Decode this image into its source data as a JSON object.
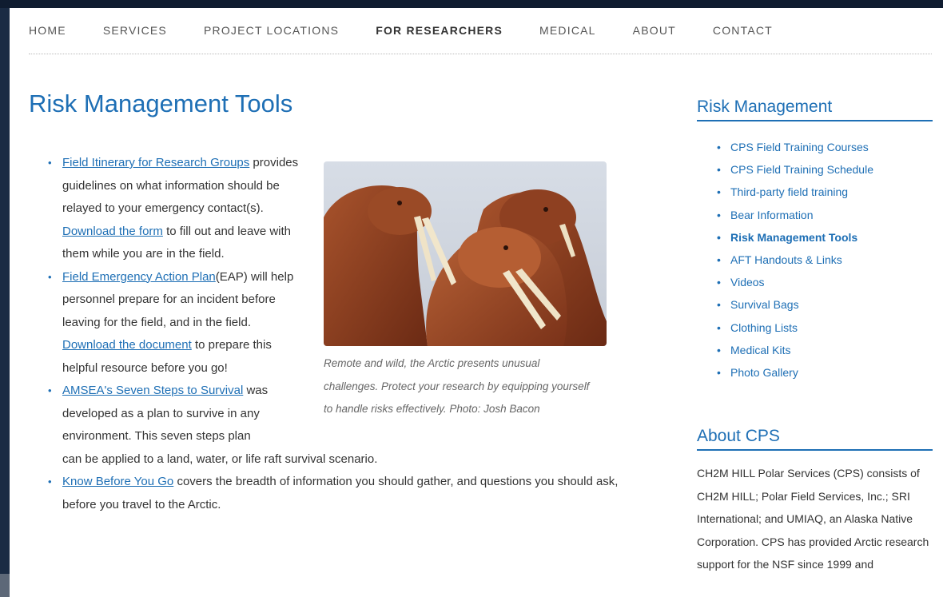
{
  "nav": {
    "items": [
      {
        "label": "HOME"
      },
      {
        "label": "SERVICES"
      },
      {
        "label": "PROJECT LOCATIONS"
      },
      {
        "label": "FOR RESEARCHERS"
      },
      {
        "label": "MEDICAL"
      },
      {
        "label": "ABOUT"
      },
      {
        "label": "CONTACT"
      }
    ],
    "active": "FOR RESEARCHERS"
  },
  "page_title": "Risk Management Tools",
  "items": [
    {
      "link1": "Field Itinerary for Research Groups",
      "text1": " provides guidelines on what information should be relayed to your emergency contact(s). ",
      "link2": "Download the form",
      "text2": " to fill out and leave with them while you are in the field."
    },
    {
      "link1": "Field Emergency Action Plan",
      "text1": "(EAP) will help personnel prepare for an incident before leaving for the field, and in the field. ",
      "link2": "Download the document",
      "text2": " to prepare this helpful resource before you go!"
    },
    {
      "link1": "AMSEA's Seven Steps to Survival",
      "text1": " was developed as a plan to survive in any environment. This seven steps plan",
      "text2": "can be applied to a land, water, or life raft survival scenario."
    },
    {
      "link1": "Know Before You Go",
      "text1": " covers the breadth of information you should gather, and questions you should ask, before you travel to the Arctic."
    }
  ],
  "photo": {
    "caption": "Remote and wild, the Arctic presents unusual challenges. Protect your research by equipping yourself to handle risks effectively. Photo: Josh Bacon"
  },
  "sidebar": {
    "heading": "Risk Management",
    "links": [
      "CPS Field Training Courses",
      "CPS Field Training Schedule",
      "Third-party field training",
      "Bear Information",
      "Risk Management Tools",
      "AFT Handouts & Links",
      "Videos",
      "Survival Bags",
      "Clothing Lists",
      "Medical Kits",
      "Photo Gallery"
    ],
    "current": "Risk Management Tools"
  },
  "about": {
    "heading": "About CPS",
    "text": "CH2M HILL Polar Services (CPS) consists of CH2M HILL; Polar Field Services, Inc.; SRI International; and UMIAQ, an Alaska Native Corporation. CPS has provided Arctic research support for the NSF since 1999 and"
  },
  "colors": {
    "accent": "#1e6fb5",
    "frame": "#14233a"
  }
}
